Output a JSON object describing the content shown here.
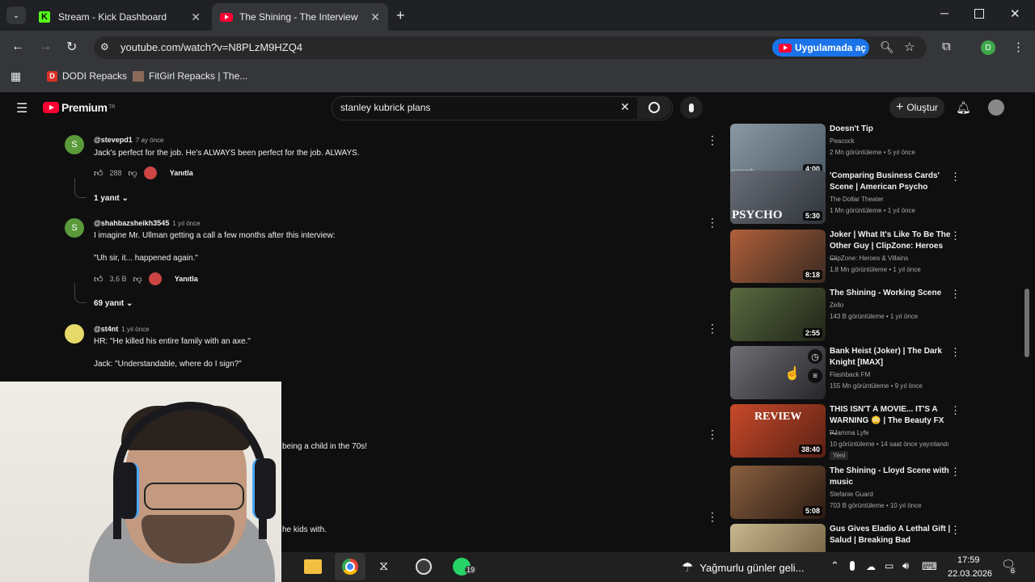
{
  "browser": {
    "tabs": [
      {
        "label": "Stream - Kick Dashboard",
        "icon": "kick-logo-icon"
      },
      {
        "label": "The Shining - The Interview Sce",
        "icon": "youtube-logo-icon"
      }
    ],
    "url": "youtube.com/watch?v=N8PLzM9HZQ4",
    "open_in_app": "Uygulamada aç",
    "profile_initial": "D",
    "bookmarks": [
      "DODI Repacks",
      "FitGirl Repacks | The..."
    ]
  },
  "youtube": {
    "logo": "Premium",
    "logo_sup": "TR",
    "search_query": "stanley kubrick plans",
    "create_label": "Oluştur"
  },
  "comments": [
    {
      "avatar": "S",
      "avatar_color": "#5a9a3a",
      "handle": "@stevepd1",
      "time": "7 ay önce",
      "text": "Jack's perfect for the job. He's ALWAYS been perfect for the job. ALWAYS.",
      "likes": "288",
      "reply": "Yanıtla",
      "replies": "1 yanıt"
    },
    {
      "avatar": "S",
      "avatar_color": "#5a9a3a",
      "handle": "@shahbazsheikh3545",
      "time": "1 yıl önce",
      "text": "I imagine Mr. Ullman getting a call a few months after this interview:",
      "text2": "\"Uh sir, it... happened again.\"",
      "likes": "3,6 B",
      "reply": "Yanıtla",
      "replies": "69 yanıt"
    },
    {
      "avatar": "",
      "avatar_color": "#e6d96a",
      "handle": "@st4nt",
      "time": "1 yıl önce",
      "text": "HR: \"He killed his entire family with an axe.\"",
      "text2": "Jack: \"Understandable, where do I sign?\""
    }
  ],
  "partial_comments": [
    "being a child in the 70s!",
    "he kids with."
  ],
  "sidebar": [
    {
      "title": "Doesn't Tip",
      "channel": "Peacock",
      "stats": "2 Mn görüntüleme • 5 yıl önce",
      "duration": "4:00",
      "thumb": "#6b7a86",
      "overlay": "peacock"
    },
    {
      "title": "'Comparing Business Cards' Scene | American Psycho",
      "channel": "The Dollar Theater",
      "stats": "1 Mn görüntüleme • 1 yıl önce",
      "duration": "5:30",
      "thumb": "#4a4f58",
      "overlay": "PSYCHO"
    },
    {
      "title": "Joker | What It's Like To Be The Other Guy | ClipZone: Heroes ...",
      "channel": "ClipZone: Heroes & Villains",
      "stats": "1,8 Mn görüntüleme • 1 yıl önce",
      "duration": "8:18",
      "thumb": "#8a4b2a"
    },
    {
      "title": "The Shining - Working Scene",
      "channel": "Zello",
      "stats": "143 B görüntüleme • 1 yıl önce",
      "duration": "2:55",
      "thumb": "#3b4230"
    },
    {
      "title": "Bank Heist (Joker) | The Dark Knight [IMAX]",
      "channel": "Flashback FM",
      "stats": "155 Mn görüntüleme • 9 yıl önce",
      "duration": "",
      "thumb": "#4a4a50"
    },
    {
      "title": "THIS ISN'T A MOVIE... IT'S A WARNING 😳 | The Beauty FX ...",
      "channel": "PJamma Lyfe",
      "stats": "10 görüntüleme • 14 saat önce yayınlandı",
      "badge": "Yeni",
      "duration": "38:40",
      "thumb": "#a83a22",
      "overlay": "REVIEW"
    },
    {
      "title": "The Shining - Lloyd Scene with music",
      "channel": "Stefanie Guard",
      "stats": "703 B görüntüleme • 10 yıl önce",
      "duration": "5:08",
      "thumb": "#5a3b28"
    },
    {
      "title": "Gus Gives Eladio A Lethal Gift | Salud | Breaking Bad",
      "channel": "",
      "stats": "",
      "duration": "",
      "thumb": "#9a8a6a"
    }
  ],
  "taskbar": {
    "weather": "Yağmurlu günler geli...",
    "time": "17:59",
    "date": "22.03.2026",
    "whatsapp_count": "19",
    "notif_count": "6"
  }
}
